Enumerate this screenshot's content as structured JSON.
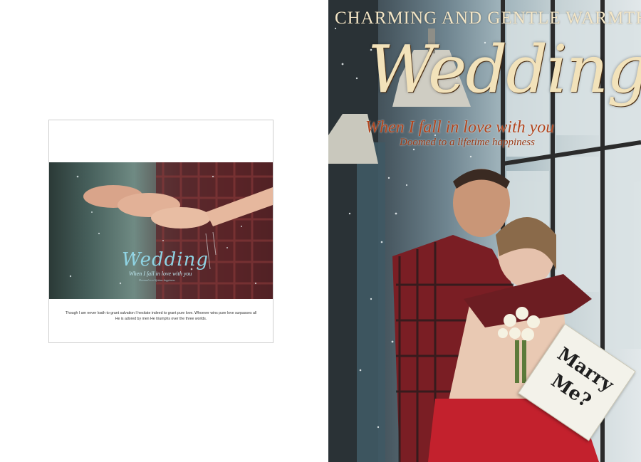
{
  "left_page": {
    "logo_word": "Wedding",
    "logo_subtitle": "When I fall in love with you",
    "logo_subtitle2": "Doomed to a lifetime happiness",
    "caption_line1": "Though I am never loath to grant salvation  I hesitate indeed to grant pure love. Whoever wins pure love surpasses all",
    "caption_line2": "He is adored by men  He triumphs over the three worlds."
  },
  "right_page": {
    "headline": "CHARMING AND GENTLE WARMTH",
    "wedding_word": "Wedding",
    "tagline": "When I fall in love with you",
    "subtagline": "Doomed to a lifetime happiness",
    "sign_line1": "Marry",
    "sign_line2": "Me?"
  },
  "colors": {
    "headline": "#f4e6c6",
    "tagline": "#b2451d",
    "left_logo": "#8fd3e3"
  }
}
